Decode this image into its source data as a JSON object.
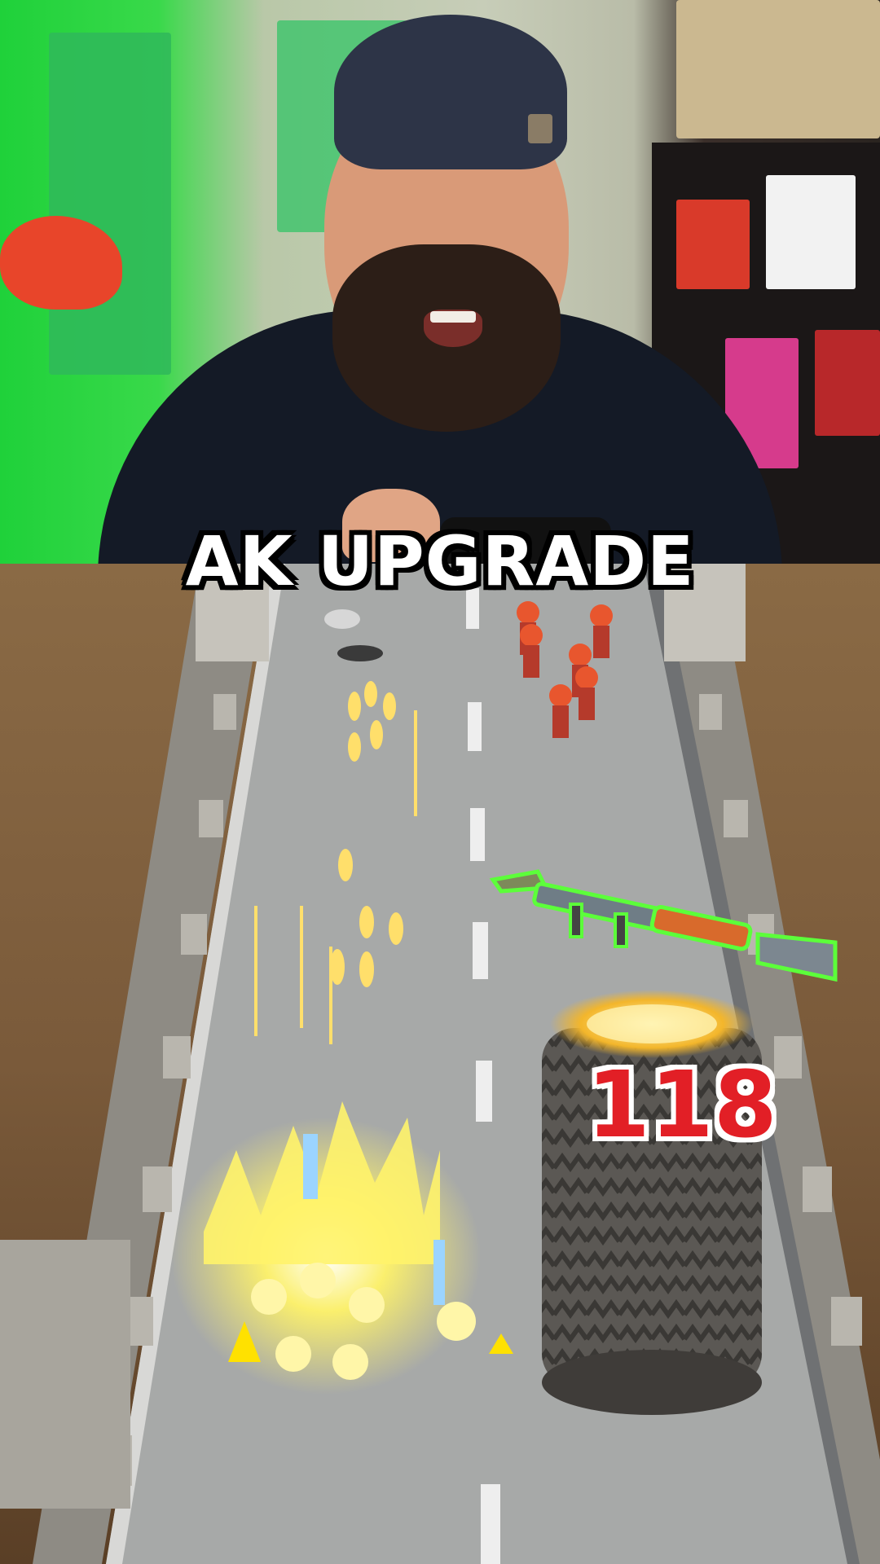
{
  "caption": {
    "text": "AK UPGRADE"
  },
  "game": {
    "obstacle_counter": "118",
    "weapon_pickup_icon": "rocket-launcher-icon",
    "accent_colors": {
      "counter_red": "#e21f26",
      "weapon_outline": "#5cff3a",
      "energy_yellow": "#fff36a"
    }
  }
}
